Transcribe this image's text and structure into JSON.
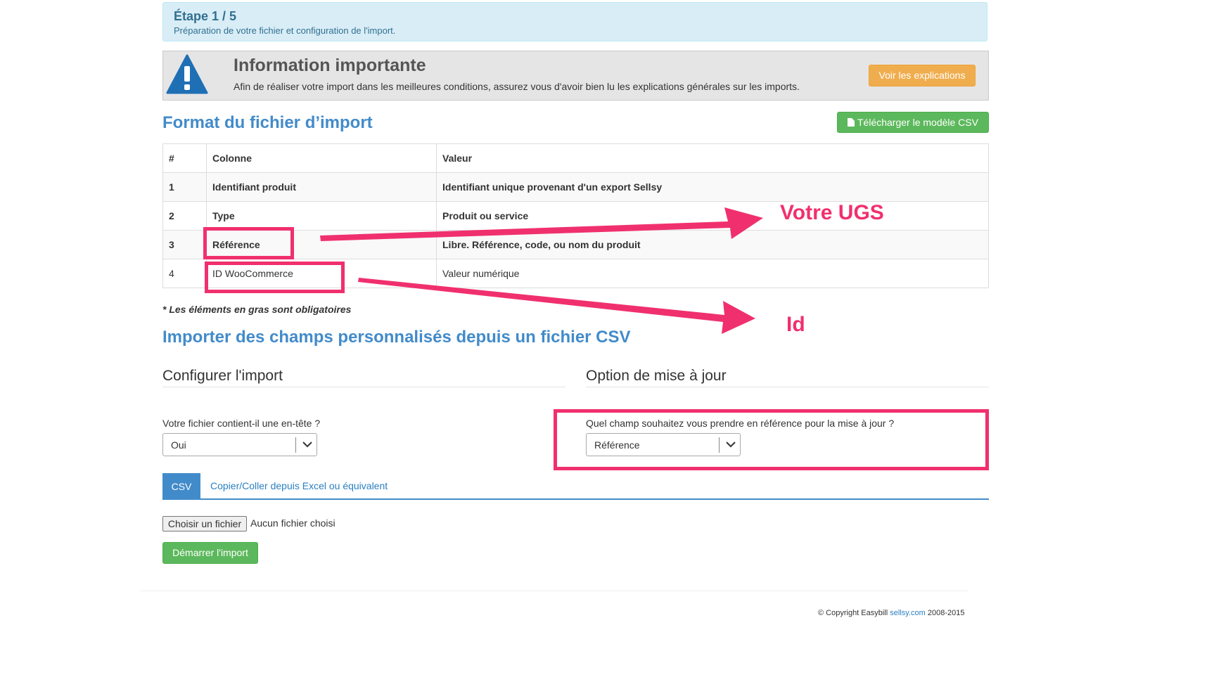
{
  "step": {
    "title": "Étape 1 / 5",
    "subtitle": "Préparation de votre fichier et configuration de l'import."
  },
  "info": {
    "title": "Information importante",
    "text": "Afin de réaliser votre import dans les meilleures conditions, assurez vous d'avoir bien lu les explications générales sur les imports.",
    "button": "Voir les explications"
  },
  "format": {
    "title": "Format du fichier d’import",
    "download_button": "Télécharger le modèle CSV",
    "columns": [
      "#",
      "Colonne",
      "Valeur"
    ],
    "rows": [
      {
        "num": "1",
        "col": "Identifiant produit",
        "val": "Identifiant unique provenant d'un export Sellsy"
      },
      {
        "num": "2",
        "col": "Type",
        "val": "Produit ou service"
      },
      {
        "num": "3",
        "col": "Référence",
        "val": "Libre. Référence, code, ou nom du produit"
      },
      {
        "num": "4",
        "col": "ID WooCommerce",
        "val": "Valeur numérique"
      }
    ],
    "note": "* Les éléments en gras sont obligatoires"
  },
  "custom_fields_title": "Importer des champs personnalisés depuis un fichier CSV",
  "config": {
    "title": "Configurer l'import",
    "header_question": "Votre fichier contient-il une en-tête ?",
    "header_value": "Oui"
  },
  "update": {
    "title": "Option de mise à jour",
    "question": "Quel champ souhaitez vous prendre en référence pour la mise à jour ?",
    "value": "Référence"
  },
  "tabs": {
    "active": "CSV",
    "other": "Copier/Coller depuis Excel ou équivalent"
  },
  "file": {
    "button": "Choisir un fichier",
    "status": "Aucun fichier choisi"
  },
  "start_button": "Démarrer l'import",
  "footer": {
    "prefix": "© Copyright Easybill ",
    "link": "sellsy.com",
    "suffix": " 2008-2015"
  },
  "annotations": {
    "ugs": "Votre UGS",
    "id": "Id"
  },
  "colors": {
    "primary": "#428bca",
    "success": "#5cb85c",
    "warning": "#f0ad4e",
    "annotation": "#f0306e"
  },
  "icons": {
    "warning": "warning-icon",
    "file": "file-icon",
    "chevron": "chevron-down-icon"
  }
}
